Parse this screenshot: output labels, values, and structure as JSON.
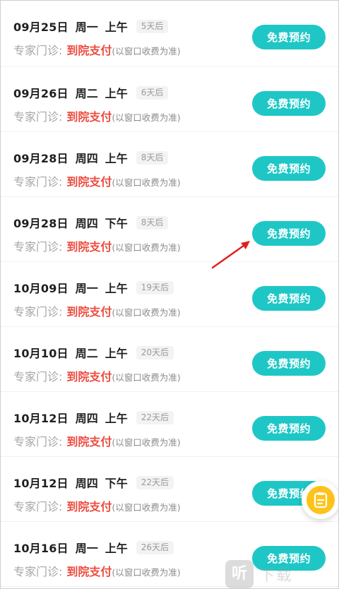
{
  "rows": [
    {
      "date": "09月25日",
      "weekday": "周一",
      "period": "上午",
      "days": "5天后",
      "label": "专家门诊:",
      "pay": "到院支付",
      "note": "(以窗口收费为准)",
      "button": "免费预约"
    },
    {
      "date": "09月26日",
      "weekday": "周二",
      "period": "上午",
      "days": "6天后",
      "label": "专家门诊:",
      "pay": "到院支付",
      "note": "(以窗口收费为准)",
      "button": "免费预约"
    },
    {
      "date": "09月28日",
      "weekday": "周四",
      "period": "上午",
      "days": "8天后",
      "label": "专家门诊:",
      "pay": "到院支付",
      "note": "(以窗口收费为准)",
      "button": "免费预约"
    },
    {
      "date": "09月28日",
      "weekday": "周四",
      "period": "下午",
      "days": "8天后",
      "label": "专家门诊:",
      "pay": "到院支付",
      "note": "(以窗口收费为准)",
      "button": "免费预约"
    },
    {
      "date": "10月09日",
      "weekday": "周一",
      "period": "上午",
      "days": "19天后",
      "label": "专家门诊:",
      "pay": "到院支付",
      "note": "(以窗口收费为准)",
      "button": "免费预约"
    },
    {
      "date": "10月10日",
      "weekday": "周二",
      "period": "上午",
      "days": "20天后",
      "label": "专家门诊:",
      "pay": "到院支付",
      "note": "(以窗口收费为准)",
      "button": "免费预约"
    },
    {
      "date": "10月12日",
      "weekday": "周四",
      "period": "上午",
      "days": "22天后",
      "label": "专家门诊:",
      "pay": "到院支付",
      "note": "(以窗口收费为准)",
      "button": "免费预约"
    },
    {
      "date": "10月12日",
      "weekday": "周四",
      "period": "下午",
      "days": "22天后",
      "label": "专家门诊:",
      "pay": "到院支付",
      "note": "(以窗口收费为准)",
      "button": "免费预约"
    },
    {
      "date": "10月16日",
      "weekday": "周一",
      "period": "上午",
      "days": "26天后",
      "label": "专家门诊:",
      "pay": "到院支付",
      "note": "(以窗口收费为准)",
      "button": "免费预约"
    }
  ],
  "colors": {
    "button": "#1ec7c6",
    "pay": "#ee4b3f",
    "arrow": "#e02020",
    "float": "#ffc21a"
  },
  "icons": {
    "arrow": "red-arrow-icon",
    "float": "note-icon",
    "watermark": "listen-logo-icon"
  },
  "watermark": {
    "glyph": "听",
    "text": "下载"
  }
}
